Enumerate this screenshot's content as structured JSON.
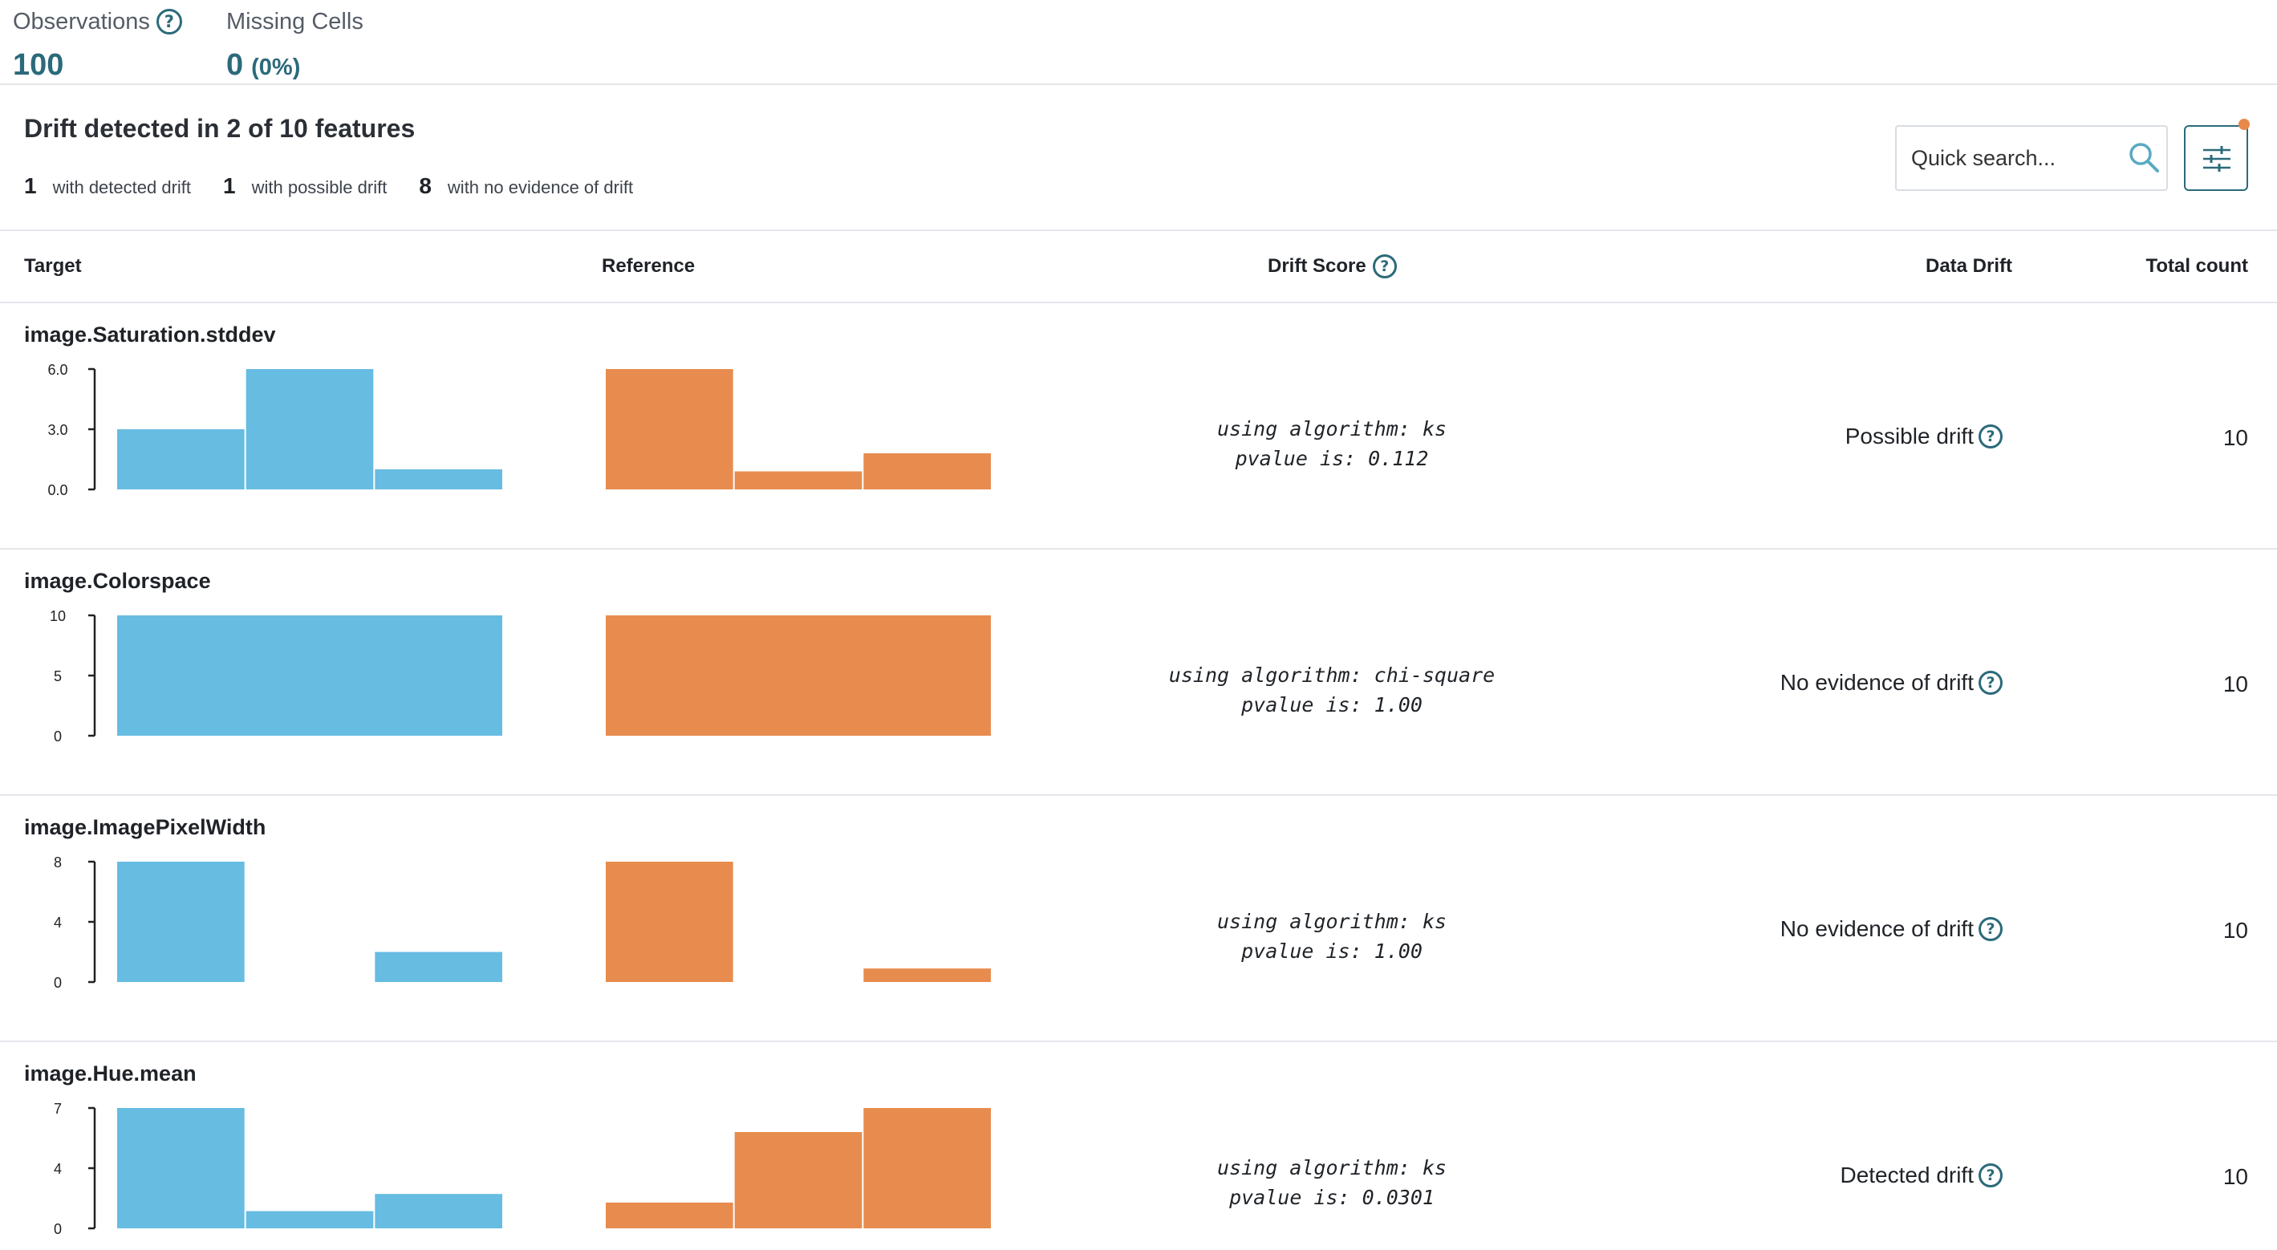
{
  "summary": {
    "observations_label": "Observations",
    "observations_value": "100",
    "missing_label": "Missing Cells",
    "missing_value": "0",
    "missing_pct": "(0%)"
  },
  "drift": {
    "title": "Drift detected in 2 of 10 features",
    "counts": [
      {
        "num": "1",
        "label": "with detected drift"
      },
      {
        "num": "1",
        "label": "with possible drift"
      },
      {
        "num": "8",
        "label": "with no evidence of drift"
      }
    ]
  },
  "search": {
    "placeholder": "Quick search..."
  },
  "columns": {
    "target": "Target",
    "reference": "Reference",
    "drift_score": "Drift Score",
    "data_drift": "Data Drift",
    "total_count": "Total count"
  },
  "colors": {
    "target_bar": "#67bce2",
    "reference_bar": "#e78c4e",
    "accent": "#2b6a7a",
    "notify": "#e8894a"
  },
  "icons": {
    "help": "question-circle-icon",
    "search": "search-icon",
    "filter": "sliders-icon"
  },
  "rows": [
    {
      "name": "image.Saturation.stddev",
      "score_line1": "using algorithm: ks",
      "score_line2": "pvalue is: 0.112",
      "status": "Possible drift",
      "total": "10",
      "y_ticks": [
        "6.0",
        "3.0",
        "0.0"
      ],
      "y_max": 6,
      "target_values": [
        3,
        6,
        1
      ],
      "reference_values": [
        6,
        0.9,
        1.8
      ]
    },
    {
      "name": "image.Colorspace",
      "score_line1": "using algorithm: chi-square",
      "score_line2": "pvalue is: 1.00",
      "status": "No evidence of drift",
      "total": "10",
      "y_ticks": [
        "10",
        "5",
        "0"
      ],
      "y_max": 10,
      "target_values": [
        10
      ],
      "reference_values": [
        10
      ]
    },
    {
      "name": "image.ImagePixelWidth",
      "score_line1": "using algorithm: ks",
      "score_line2": "pvalue is: 1.00",
      "status": "No evidence of drift",
      "total": "10",
      "y_ticks": [
        "8",
        "4",
        "0"
      ],
      "y_max": 8,
      "target_values": [
        8,
        0,
        2
      ],
      "reference_values": [
        8,
        0,
        0.9
      ]
    },
    {
      "name": "image.Hue.mean",
      "score_line1": "using algorithm: ks",
      "score_line2": "pvalue is: 0.0301",
      "status": "Detected drift",
      "total": "10",
      "y_ticks": [
        "7",
        "4",
        "0"
      ],
      "y_max": 7,
      "target_values": [
        7,
        1,
        2
      ],
      "reference_values": [
        1.5,
        5.6,
        7
      ]
    }
  ]
}
